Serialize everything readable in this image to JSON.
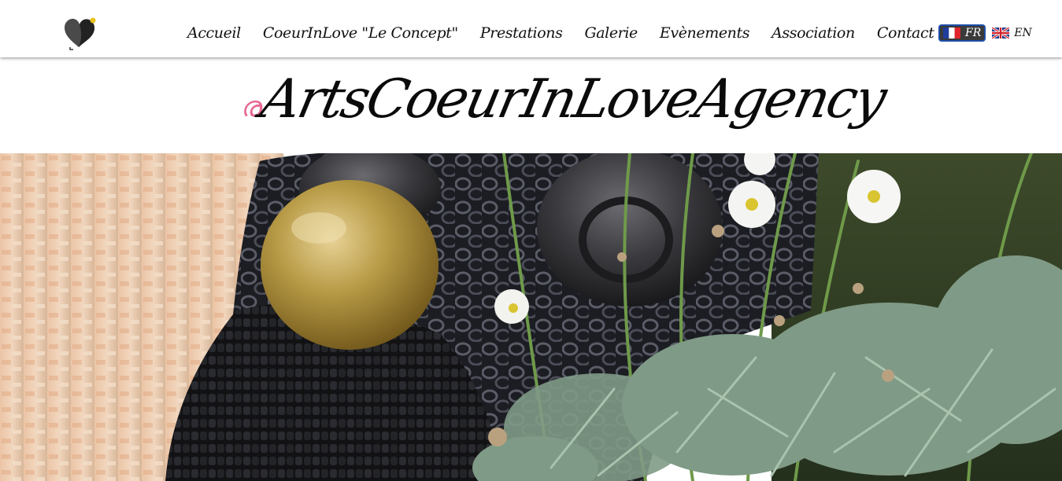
{
  "header": {
    "logo_icon": "heart-logo-icon",
    "nav": [
      {
        "label": "Accueil"
      },
      {
        "label": "CoeurInLove \"Le Concept\""
      },
      {
        "label": "Prestations"
      },
      {
        "label": "Galerie"
      },
      {
        "label": "Evènements"
      },
      {
        "label": "Association"
      },
      {
        "label": "Contact"
      }
    ],
    "languages": [
      {
        "code": "FR",
        "flag_icon": "france-flag-icon",
        "active": true
      },
      {
        "code": "EN",
        "flag_icon": "uk-flag-icon",
        "active": false
      }
    ]
  },
  "brand": {
    "title": "ArtsCoeurInLoveAgency",
    "ornament_color": "#e86a92"
  },
  "hero": {
    "subject_icon": "sculpture-with-flowers-image"
  },
  "colors": {
    "active_lang_bg": "#3a3a3a",
    "active_lang_border": "#1e4fa8",
    "text": "#111111"
  }
}
